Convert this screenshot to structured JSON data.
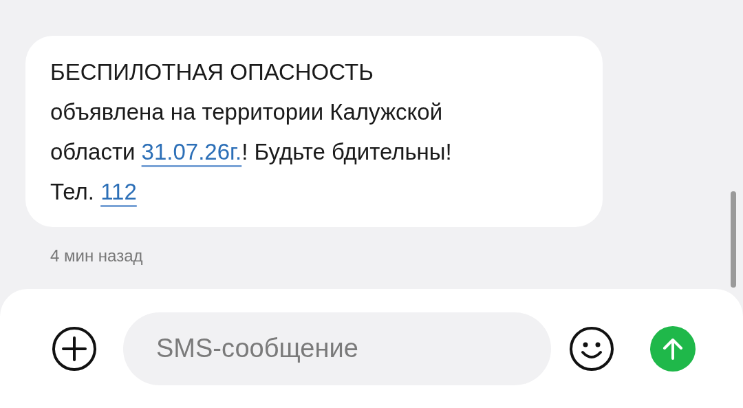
{
  "message": {
    "parts": [
      {
        "kind": "text",
        "text": "БЕСПИЛОТНАЯ ОПАСНОСТЬ\nобъявлена на территории Калужской\nобласти "
      },
      {
        "kind": "link",
        "text": "31.07.26г."
      },
      {
        "kind": "text",
        "text": "! Будьте бдительны!\nТел. "
      },
      {
        "kind": "link",
        "text": "112"
      }
    ],
    "time": "4 мин назад"
  },
  "composer": {
    "placeholder": "SMS-сообщение"
  }
}
